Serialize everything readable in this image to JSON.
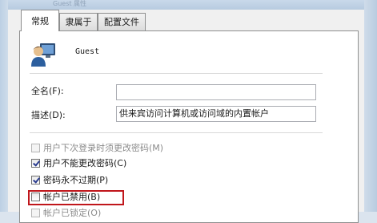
{
  "window": {
    "title": "Guest 属性"
  },
  "tabs": [
    {
      "label": "常规",
      "active": true
    },
    {
      "label": "隶属于",
      "active": false
    },
    {
      "label": "配置文件",
      "active": false
    }
  ],
  "user": {
    "name": "Guest",
    "icon": "user-account-icon"
  },
  "fields": {
    "full_name_label": "全名(F):",
    "full_name_value": "",
    "description_label": "描述(D):",
    "description_value": "供来宾访问计算机或访问域的内置帐户"
  },
  "options": [
    {
      "label": "用户下次登录时须更改密码(M)",
      "checked": false,
      "disabled": true
    },
    {
      "label": "用户不能更改密码(C)",
      "checked": true,
      "disabled": false
    },
    {
      "label": "密码永不过期(P)",
      "checked": true,
      "disabled": false
    },
    {
      "label": "帐户已禁用(B)",
      "checked": false,
      "disabled": false,
      "highlighted": true
    },
    {
      "label": "帐户已锁定(O)",
      "checked": false,
      "disabled": true
    }
  ],
  "colors": {
    "highlight": "#c0161b",
    "checkmark": "#2a3b8f"
  }
}
